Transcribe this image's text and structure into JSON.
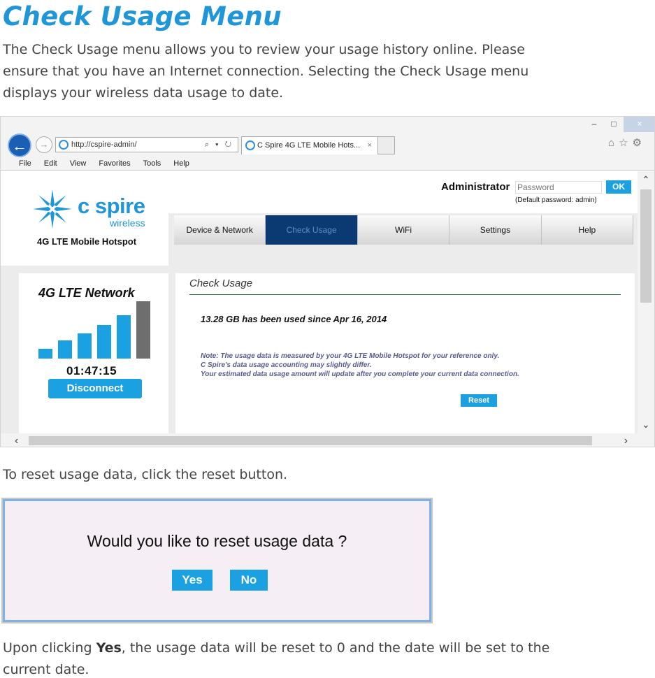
{
  "doc": {
    "title": "Check Usage Menu",
    "intro_lines": [
      "The Check Usage menu allows you to review your usage history online. Please",
      "ensure that you have an Internet connection. Selecting the Check Usage menu",
      "displays your wireless data usage to date."
    ],
    "reset_instruction": "To reset usage data, click the reset button.",
    "outro_prefix": "Upon clicking ",
    "outro_bold": "Yes",
    "outro_suffix": ", the usage data will be reset to 0 and the date will be set to the",
    "outro_line2": "current date."
  },
  "browser": {
    "url": "http://cspire-admin/",
    "address_tools": "⌕ ▾ ↻",
    "tab_title": "C Spire 4G LTE Mobile Hots...",
    "tab_close": "×",
    "window_buttons": [
      "–",
      "□",
      "×"
    ],
    "right_icons": "⌂☆⚙",
    "menu": [
      "File",
      "Edit",
      "View",
      "Favorites",
      "Tools",
      "Help"
    ],
    "back_glyph": "←",
    "forward_glyph": "→",
    "scroll_up": "⌃",
    "scroll_down": "⌄",
    "scroll_left": "‹",
    "scroll_right": "›"
  },
  "site": {
    "logo_word": "c spire",
    "logo_sub": "wireless",
    "product": "4G LTE Mobile Hotspot",
    "admin_label": "Administrator",
    "password_placeholder": "Password",
    "ok_label": "OK",
    "default_password_note": "(Default password: admin)",
    "nav": [
      "Device & Network",
      "Check Usage",
      "WiFi",
      "Settings",
      "Help"
    ],
    "nav_active_index": 1
  },
  "network": {
    "title": "4G LTE Network",
    "signal_bars_lit": 5,
    "signal_bars_total": 6,
    "timer": "01:47:15",
    "disconnect_label": "Disconnect"
  },
  "usage": {
    "section_title": "Check Usage",
    "summary": "13.28 GB has been used since Apr 16, 2014",
    "note_lines": [
      "Note: The usage data is measured by your 4G LTE Mobile Hotspot for your reference only.",
      "C Spire's data usage accounting may slightly differ.",
      "Your estimated data usage amount will update after you complete your current data connection."
    ],
    "reset_label": "Reset"
  },
  "dialog": {
    "question": "Would you like to reset usage data ?",
    "yes_label": "Yes",
    "no_label": "No"
  },
  "colors": {
    "accent": "#1e96d8",
    "button_blue": "#1ba1e2",
    "nav_active": "#0b3a73"
  }
}
